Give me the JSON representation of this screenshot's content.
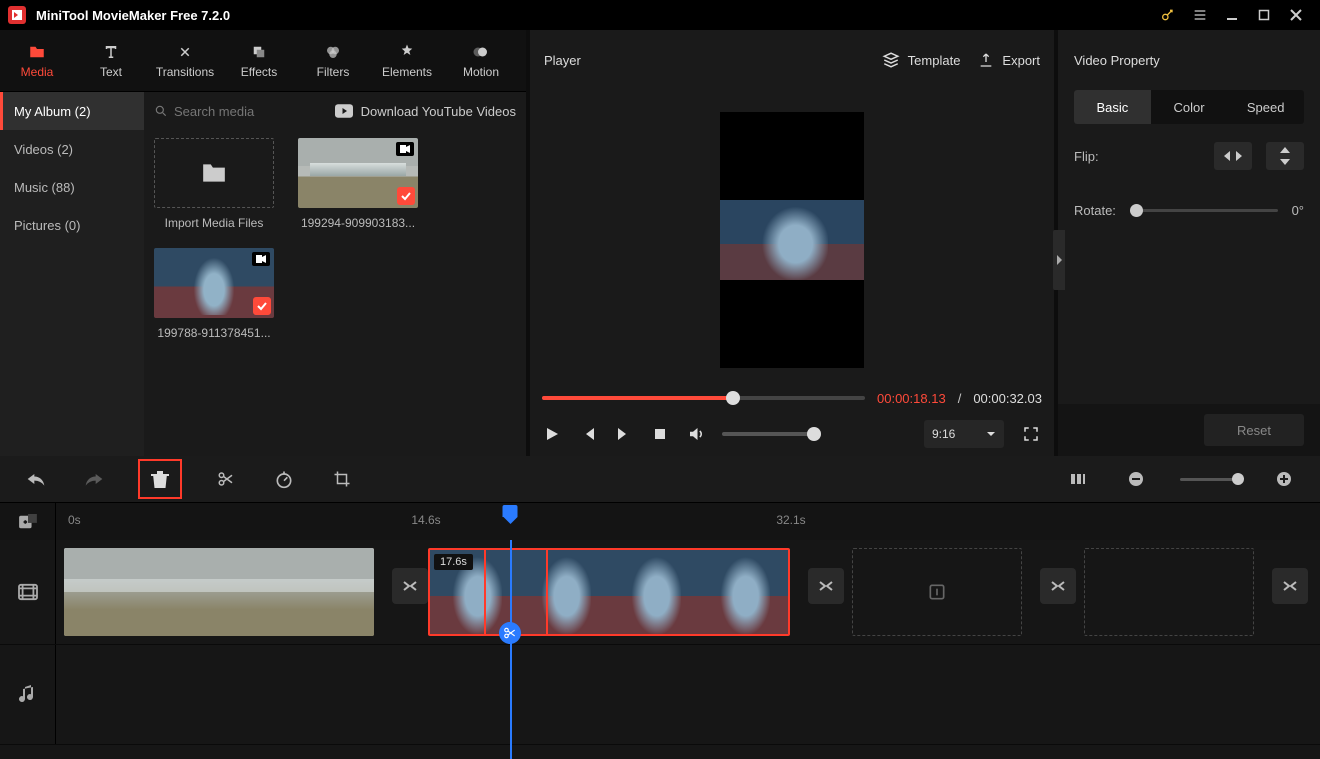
{
  "titlebar": {
    "title": "MiniTool MovieMaker Free 7.2.0"
  },
  "tool_tabs": {
    "media": "Media",
    "text": "Text",
    "transitions": "Transitions",
    "effects": "Effects",
    "filters": "Filters",
    "elements": "Elements",
    "motion": "Motion"
  },
  "sidebar": {
    "my_album": "My Album (2)",
    "videos": "Videos (2)",
    "music": "Music (88)",
    "pictures": "Pictures (0)"
  },
  "media_bar": {
    "search_placeholder": "Search media",
    "download_yt": "Download YouTube Videos"
  },
  "media_items": {
    "import_caption": "Import Media Files",
    "clip1_caption": "199294-909903183...",
    "clip2_caption": "199788-911378451..."
  },
  "player": {
    "title": "Player",
    "template": "Template",
    "export": "Export",
    "time_current": "00:00:18.13",
    "time_sep": "/",
    "time_duration": "00:00:32.03",
    "aspect": "9:16"
  },
  "property": {
    "title": "Video Property",
    "tabs": {
      "basic": "Basic",
      "color": "Color",
      "speed": "Speed"
    },
    "flip_label": "Flip:",
    "rotate_label": "Rotate:",
    "rotate_value": "0°",
    "reset": "Reset"
  },
  "timeline": {
    "ruler": {
      "t0": "0s",
      "t1": "14.6s",
      "t2": "32.1s"
    },
    "clip2_duration": "17.6s"
  }
}
